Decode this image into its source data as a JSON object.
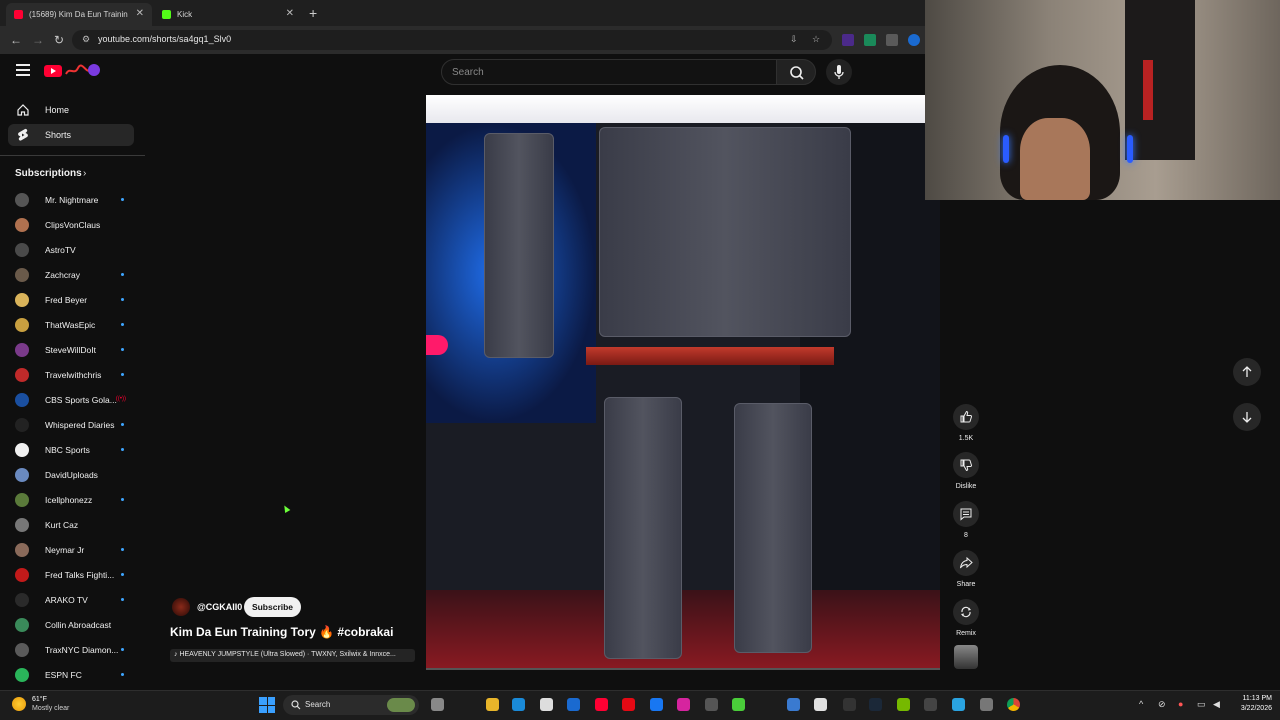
{
  "browser": {
    "tabs": [
      {
        "title": "(15689) Kim Da Eun Trainin",
        "active": true
      },
      {
        "title": "Kick",
        "active": false
      }
    ],
    "url": "youtube.com/shorts/sa4gq1_Slv0"
  },
  "header": {
    "search_placeholder": "Search"
  },
  "sidebar": {
    "items": [
      {
        "label": "Home",
        "icon": "home-icon"
      },
      {
        "label": "Shorts",
        "icon": "shorts-icon",
        "selected": true
      }
    ],
    "subscriptions_title": "Subscriptions",
    "subscriptions": [
      {
        "name": "Mr. Nightmare",
        "color": "#555555",
        "new": true
      },
      {
        "name": "ClipsVonClaus",
        "color": "#b0714f",
        "new": false
      },
      {
        "name": "AstroTV",
        "color": "#4a4a4a",
        "new": false
      },
      {
        "name": "Zachcray",
        "color": "#6a5a4a",
        "new": true
      },
      {
        "name": "Fred Beyer",
        "color": "#d9b35a",
        "new": true
      },
      {
        "name": "ThatWasEpic",
        "color": "#c9a040",
        "new": true
      },
      {
        "name": "SteveWillDoIt",
        "color": "#7a3a8a",
        "new": true
      },
      {
        "name": "Travelwithchris",
        "color": "#c02a2a",
        "new": true
      },
      {
        "name": "CBS Sports Gola...",
        "color": "#1a4fa0",
        "live": true
      },
      {
        "name": "Whispered Diaries",
        "color": "#222222",
        "new": true
      },
      {
        "name": "NBC Sports",
        "color": "#f0f0f0",
        "new": true
      },
      {
        "name": "DavidUploads",
        "color": "#6a8ac0",
        "new": false
      },
      {
        "name": "Icellphonezz",
        "color": "#5a7a3a",
        "new": true
      },
      {
        "name": "Kurt Caz",
        "color": "#777777",
        "new": false
      },
      {
        "name": "Neymar Jr",
        "color": "#8a6a5a",
        "new": true
      },
      {
        "name": "Fred Talks Fighti...",
        "color": "#c21a1a",
        "new": true
      },
      {
        "name": "ARAKO TV",
        "color": "#2a2a2a",
        "new": true
      },
      {
        "name": "Collin Abroadcast",
        "color": "#3a8a5a",
        "new": false
      },
      {
        "name": "TraxNYC Diamon...",
        "color": "#5a5a5a",
        "new": true
      },
      {
        "name": "ESPN FC",
        "color": "#2ab55a",
        "new": true
      }
    ]
  },
  "video": {
    "channel_handle": "@CGKAII0",
    "subscribe_label": "Subscribe",
    "title": "Kim Da Eun Training Tory 🔥 #cobrakai",
    "music": "♪ HEAVENLY JUMPSTYLE (Ultra Slowed) · TWXNY, Sxilwix & Innxce..."
  },
  "actions": {
    "like_count": "1.5K",
    "dislike_label": "Dislike",
    "comments_count": "8",
    "share_label": "Share",
    "remix_label": "Remix"
  },
  "taskbar": {
    "weather_temp": "61°F",
    "weather_desc": "Mostly clear",
    "search_label": "Search",
    "time": "11:13 PM",
    "date": "3/22/2026"
  }
}
